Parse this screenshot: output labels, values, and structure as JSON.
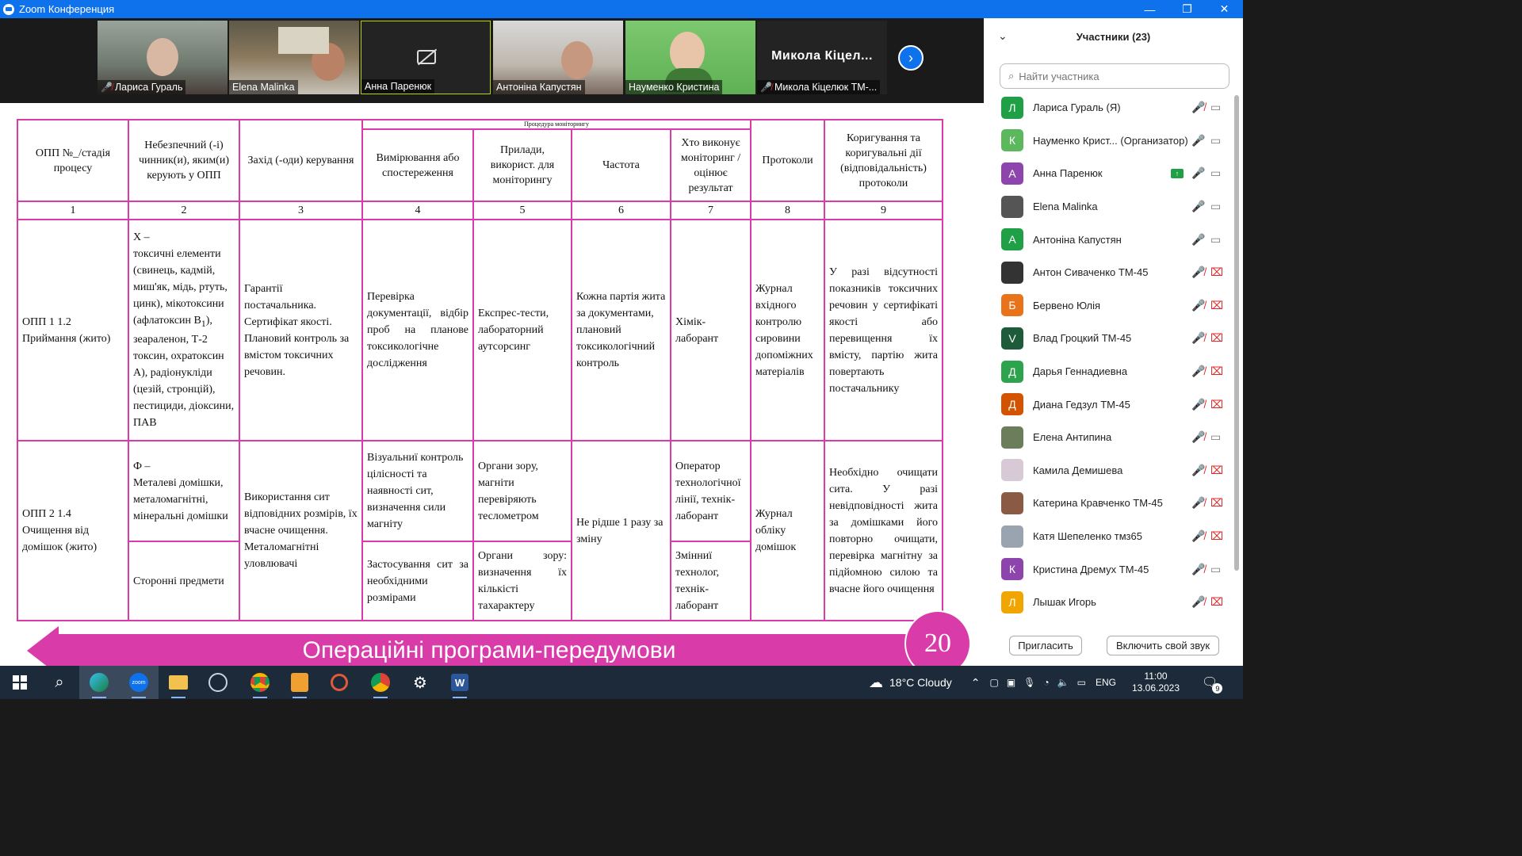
{
  "window": {
    "title": "Zoom Конференция",
    "minimize": "—",
    "maximize": "❐",
    "close": "✕"
  },
  "video_strip": {
    "tiles": [
      {
        "name": "Лариса Гураль",
        "muted": true
      },
      {
        "name": "Elena Malinka",
        "muted": false
      },
      {
        "name": "Анна Паренюк",
        "muted": false,
        "video_off": true
      },
      {
        "name": "Антоніна Капустян",
        "muted": false
      },
      {
        "name": "Науменко Кристина",
        "muted": false
      },
      {
        "name": "Микола Кіцелюк ТМ-...",
        "big_name": "Микола  Кіцел...",
        "muted": true
      }
    ],
    "next": "›"
  },
  "slide": {
    "monitoring_header": "Процедура моніторингу",
    "headers": [
      "ОПП №_/стадія процесу",
      "Небезпечний (-і) чинник(и), яким(и) керують у ОПП",
      "Захід (-оди) керування",
      "Вимірювання або спостереження",
      "Прилади, використ. для моніторингу",
      "Частота",
      "Хто виконує моніторинг /оцінює результат",
      "Протоколи",
      "Коригування та коригувальні дії (відповідальність) протоколи"
    ],
    "numbers": [
      "1",
      "2",
      "3",
      "4",
      "5",
      "6",
      "7",
      "8",
      "9"
    ],
    "row1": {
      "c1": "ОПП 1 1.2 Приймання (жито)",
      "c2a": "Х –",
      "c2b": "токсичні елементи (свинець, кадмій, миш'як, мідь, ртуть, цинк), мікотоксини (афлатоксин В",
      "c2sub": "1",
      "c2c": "), зеараленон, Т-2 токсин, охратоксин А), радіонукліди (цезій, стронцій), пестициди, діоксини, ПАВ",
      "c3": "Гарантії постачальника. Сертифікат якості. Плановий контроль за вмістом токсичних речовин.",
      "c4": "Перевірка документації, відбір проб на планове токсикологічне дослідження",
      "c5": "Експрес-тести, лабораторний аутсорсинг",
      "c6": "Кожна партія жита за документами, плановий токсикологічний контроль",
      "c7": "Хімік-лаборант",
      "c8": "Журнал вхідного контролю сировини допоміжних матеріалів",
      "c9": "У разі відсутності показників токсичних речовин у сертифікаті якості або перевищення їх вмісту, партію жита повертають постачальнику"
    },
    "row2": {
      "c1": "ОПП 2 1.4 Очищення від домішок (жито)",
      "c2a": "Ф –",
      "c2b": "Металеві домішки, металомагнітні, мінеральні домішки",
      "c2c": "Сторонні предмети",
      "c3": "Використання сит відповідних розмірів, їх вчасне очищення. Металомагнітні уловлювачі",
      "c4a": "Візуальниї контроль цілісності та наявності сит, визначення сили магніту",
      "c4b": "Застосування сит за необхідними розмірами",
      "c5a": "Органи зору, магніти перевіряють теслометром",
      "c5b": "Органи зору: визначення їх кількісті тахарактеру",
      "c6": "Не рідше 1 разу за зміну",
      "c7a": "Оператор технологічної лінії, технік-лаборант",
      "c7b": "Змінниї технолог, технік-лаборант",
      "c8": "Журнал обліку домішок",
      "c9": "Необхідно очищати сита. У разі невідповідності жита за домішками його повторно очищати, перевірка магнітну за підйомною силою та вчасне його очищення"
    },
    "banner": "Операційні програми-передумови",
    "page_number": "20"
  },
  "participants": {
    "title": "Участники (23)",
    "search_placeholder": "Найти участника",
    "list": [
      {
        "initial": "Л",
        "color": "#1fa046",
        "name": "Лариса Гураль (Я)",
        "mic": "muted",
        "video": "on"
      },
      {
        "initial": "К",
        "color": "#5cb85c",
        "name": "Науменко Крист...  (Организатор)",
        "mic": "on",
        "video": "on"
      },
      {
        "initial": "А",
        "color": "#8e44ad",
        "name": "Анна Паренюк",
        "mic": "on",
        "video": "on",
        "sharing": true
      },
      {
        "initial": "",
        "color": "#555555",
        "name": "Elena Malinka",
        "mic": "on",
        "video": "on",
        "photo": true
      },
      {
        "initial": "А",
        "color": "#1fa046",
        "name": "Антоніна Капустян",
        "mic": "on",
        "video": "on"
      },
      {
        "initial": "",
        "color": "#333333",
        "name": "Антон Сиваченко ТМ-45",
        "mic": "muted",
        "video": "off",
        "photo": true
      },
      {
        "initial": "Б",
        "color": "#e8731a",
        "name": "Бервено Юлія",
        "mic": "muted",
        "video": "off"
      },
      {
        "initial": "V",
        "color": "#1e5b3a",
        "name": "Влад Гроцкий ТМ-45",
        "mic": "muted",
        "video": "off"
      },
      {
        "initial": "Д",
        "color": "#2ea34e",
        "name": "Дарья Геннадиевна",
        "mic": "muted",
        "video": "off"
      },
      {
        "initial": "Д",
        "color": "#d35400",
        "name": "Диана Гедзул ТМ-45",
        "mic": "muted",
        "video": "off"
      },
      {
        "initial": "",
        "color": "#6b7d5a",
        "name": "Елена Антипина",
        "mic": "muted",
        "video": "on",
        "photo": true
      },
      {
        "initial": "",
        "color": "#d8c9d6",
        "name": "Камила Демишева",
        "mic": "muted",
        "video": "off",
        "photo": true
      },
      {
        "initial": "",
        "color": "#8a5a44",
        "name": "Катерина Кравченко ТМ-45",
        "mic": "muted",
        "video": "off",
        "photo": true
      },
      {
        "initial": "",
        "color": "#9aa3b0",
        "name": "Катя Шепеленко тмз65",
        "mic": "muted",
        "video": "off",
        "photo": true
      },
      {
        "initial": "К",
        "color": "#8e44ad",
        "name": "Кристина Дремух ТМ-45",
        "mic": "muted",
        "video": "on"
      },
      {
        "initial": "Л",
        "color": "#f0a500",
        "name": "Лышак Игорь",
        "mic": "muted",
        "video": "off"
      }
    ],
    "invite": "Пригласить",
    "unmute_self": "Включить свой звук"
  },
  "taskbar": {
    "weather": "18°C  Cloudy",
    "language": "ENG",
    "time": "11:00",
    "date": "13.06.2023",
    "notifications": "9"
  }
}
